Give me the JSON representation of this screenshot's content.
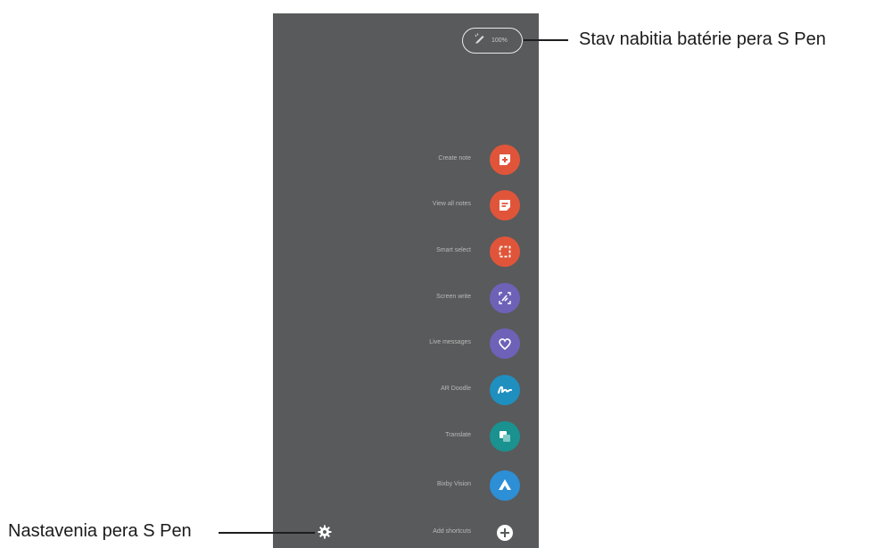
{
  "callouts": {
    "battery": "Stav nabitia batérie pera S Pen",
    "settings": "Nastavenia pera S Pen"
  },
  "pen_status": {
    "icon": "pen-icon",
    "value": "100%"
  },
  "menu": [
    {
      "label": "Create note",
      "icon": "create-note-icon",
      "color": "#e0553a"
    },
    {
      "label": "View all notes",
      "icon": "view-notes-icon",
      "color": "#e0553a"
    },
    {
      "label": "Smart select",
      "icon": "smart-select-icon",
      "color": "#e0553a"
    },
    {
      "label": "Screen write",
      "icon": "screen-write-icon",
      "color": "#6d62b8"
    },
    {
      "label": "Live messages",
      "icon": "live-messages-icon",
      "color": "#6d62b8"
    },
    {
      "label": "AR Doodle",
      "icon": "ar-doodle-icon",
      "color": "#1f8fbf"
    },
    {
      "label": "Translate",
      "icon": "translate-icon",
      "color": "#1a9290"
    },
    {
      "label": "Bixby Vision",
      "icon": "bixby-vision-icon",
      "color": "#2d8fd6"
    },
    {
      "label": "Add shortcuts",
      "icon": "add-icon",
      "color": "#ffffff"
    }
  ],
  "settings_icon": "gear-icon"
}
